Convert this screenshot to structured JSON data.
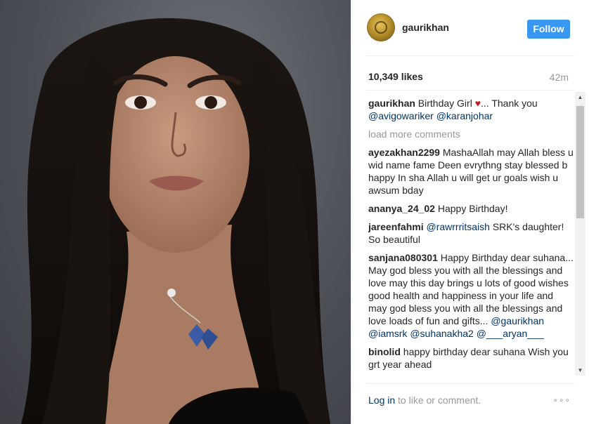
{
  "post": {
    "image_alt": "portrait photo",
    "author": "gaurikhan",
    "follow_label": "Follow",
    "likes": "10,349 likes",
    "time": "42m",
    "caption": {
      "user": "gaurikhan",
      "text_1": "Birthday Girl",
      "heart": "♥",
      "text_2": "... Thank you",
      "mention_1": "@avigowariker",
      "mention_2": "@karanjohar"
    },
    "load_more_label": "load more comments"
  },
  "comments": [
    {
      "user": "ayezakhan2299",
      "text": "MashaAllah may Allah bless u wid name fame Deen evrythng stay blessed b happy In sha Allah u will get ur goals wish u awsum bday"
    },
    {
      "user": "ananya_24_02",
      "text": "Happy Birthday!"
    },
    {
      "user": "jareenfahmi",
      "mention": "@rawrrritsaish",
      "text": "SRK's daughter! So beautiful"
    },
    {
      "user": "sanjana080301",
      "text": "Happy Birthday dear suhana... May god bless you with all the blessings and love may this day brings u lots of good wishes good health and happiness in your life and may god bless you with all the blessings and love loads of fun and gifts...",
      "mentions": "@gaurikhan @iamsrk @suhanakha2 @___aryan___"
    },
    {
      "user": "binolid",
      "text": "happy birthday dear suhana Wish you grt year ahead"
    }
  ],
  "footer": {
    "login_label": "Log in",
    "rest": "to like or comment.",
    "more_options": "∘∘∘"
  },
  "colors": {
    "follow_bg": "#3897f0",
    "mention": "#003569",
    "muted": "#999999",
    "heart": "#c51a1a"
  }
}
